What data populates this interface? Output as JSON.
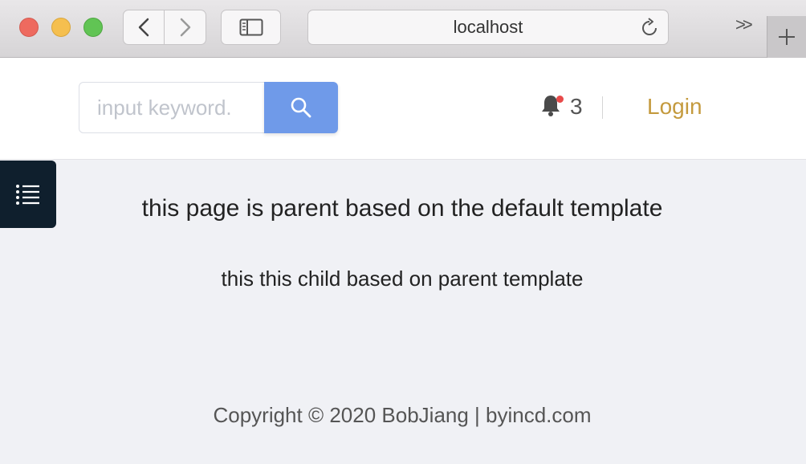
{
  "browser": {
    "address": "localhost",
    "overflow_label": ">>"
  },
  "header": {
    "search_placeholder": "input keyword.",
    "notification_count": "3",
    "login_label": "Login"
  },
  "content": {
    "parent_text": "this page is parent based on the default template",
    "child_text": "this this child based on parent template"
  },
  "footer": {
    "copyright": "Copyright © 2020 BobJiang | byincd.com"
  },
  "colors": {
    "search_button": "#6f9ae9",
    "login": "#c49a3e",
    "menu_toggle": "#0f1f2d",
    "badge": "#e84a4a"
  }
}
